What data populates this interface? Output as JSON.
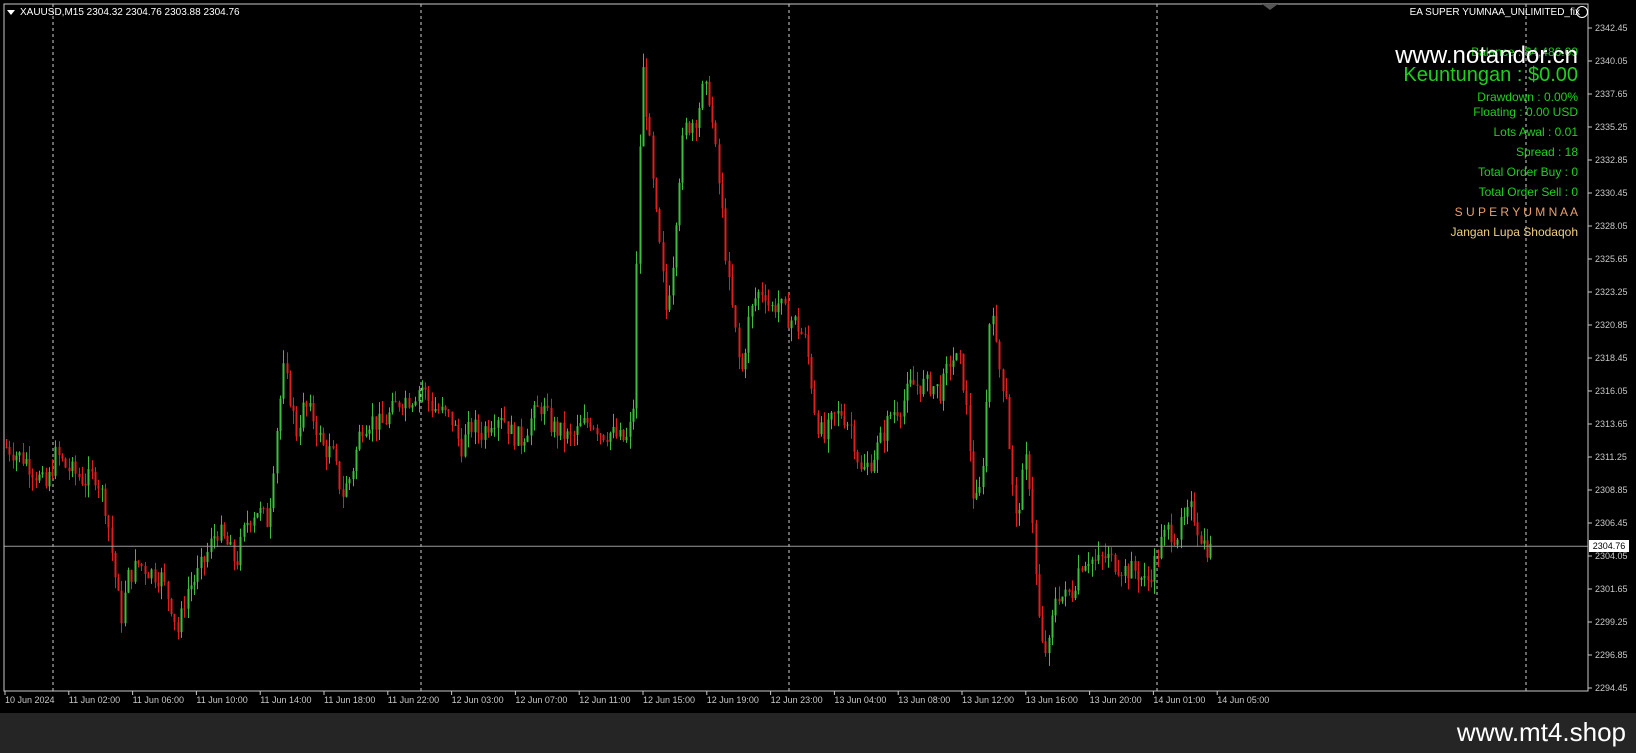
{
  "header": {
    "symbol_info": "XAUUSD,M15  2304.32 2304.76 2303.88 2304.76",
    "ea_name": "EA SUPER YUMNAA_UNLIMITED_fix"
  },
  "watermark": "www.notandor.cn",
  "panel": {
    "balance": "Balance : $4,486.09",
    "profit": "Keuntungan : $0.00",
    "drawdown": "Drawdown  : 0.00%",
    "floating": "Floating : 0.00 USD",
    "lots": "Lots Awal : 0.01",
    "spread": "Spread : 18",
    "total_buy": "Total Order Buy  :  0",
    "total_sell": "Total Order Sell  :  0",
    "brand": "S U P E R   Y U M N A A",
    "note": "Jangan Lupa Shodaqoh"
  },
  "footer": "www.mt4.shop",
  "colors": {
    "bull": "#3cbf3c",
    "bear": "#e01e1e",
    "panel_green": "#1fd01f",
    "brand_orange": "#e8a070",
    "note_yellow": "#f0d080"
  },
  "chart_data": {
    "type": "candlestick",
    "current_price": 2304.76,
    "current_price_label": "2304.76",
    "y_ticks": [
      "2342.45",
      "2340.05",
      "2337.65",
      "2335.25",
      "2332.85",
      "2330.45",
      "2328.05",
      "2325.65",
      "2323.25",
      "2320.85",
      "2318.45",
      "2316.05",
      "2313.65",
      "2311.25",
      "2308.85",
      "2306.45",
      "2304.05",
      "2301.65",
      "2299.25",
      "2296.85",
      "2294.45"
    ],
    "x_ticks": [
      "10 Jun 2024",
      "11 Jun 02:00",
      "11 Jun 06:00",
      "11 Jun 10:00",
      "11 Jun 14:00",
      "11 Jun 18:00",
      "11 Jun 22:00",
      "12 Jun 03:00",
      "12 Jun 07:00",
      "12 Jun 11:00",
      "12 Jun 15:00",
      "12 Jun 19:00",
      "12 Jun 23:00",
      "13 Jun 04:00",
      "13 Jun 08:00",
      "13 Jun 12:00",
      "13 Jun 16:00",
      "13 Jun 20:00",
      "14 Jun 01:00",
      "14 Jun 05:00"
    ],
    "close_path": [
      [
        0,
        2312.0
      ],
      [
        10,
        2311.5
      ],
      [
        20,
        2311.0
      ],
      [
        30,
        2310.0
      ],
      [
        40,
        2309.0
      ],
      [
        50,
        2311.5
      ],
      [
        60,
        2310.5
      ],
      [
        70,
        2310.0
      ],
      [
        80,
        2309.5
      ],
      [
        90,
        2310.0
      ],
      [
        100,
        2307.5
      ],
      [
        108,
        2303.0
      ],
      [
        115,
        2299.5
      ],
      [
        122,
        2302.5
      ],
      [
        132,
        2303.5
      ],
      [
        142,
        2303.0
      ],
      [
        155,
        2302.5
      ],
      [
        165,
        2300.5
      ],
      [
        172,
        2298.5
      ],
      [
        180,
        2301.5
      ],
      [
        190,
        2302.5
      ],
      [
        200,
        2304.0
      ],
      [
        210,
        2306.0
      ],
      [
        220,
        2305.0
      ],
      [
        230,
        2303.5
      ],
      [
        240,
        2306.5
      ],
      [
        250,
        2307.5
      ],
      [
        262,
        2306.5
      ],
      [
        270,
        2313.0
      ],
      [
        277,
        2317.5
      ],
      [
        283,
        2316.0
      ],
      [
        290,
        2313.0
      ],
      [
        298,
        2315.0
      ],
      [
        308,
        2314.0
      ],
      [
        316,
        2312.0
      ],
      [
        326,
        2311.5
      ],
      [
        336,
        2308.5
      ],
      [
        345,
        2310.0
      ],
      [
        355,
        2313.5
      ],
      [
        365,
        2314.0
      ],
      [
        375,
        2313.5
      ],
      [
        385,
        2314.5
      ],
      [
        395,
        2315.5
      ],
      [
        405,
        2315.5
      ],
      [
        415,
        2316.5
      ],
      [
        425,
        2315.0
      ],
      [
        435,
        2314.5
      ],
      [
        445,
        2314.0
      ],
      [
        455,
        2312.0
      ],
      [
        465,
        2313.5
      ],
      [
        475,
        2313.0
      ],
      [
        485,
        2314.0
      ],
      [
        495,
        2314.5
      ],
      [
        505,
        2313.0
      ],
      [
        515,
        2312.5
      ],
      [
        525,
        2314.0
      ],
      [
        535,
        2315.0
      ],
      [
        545,
        2313.5
      ],
      [
        555,
        2313.0
      ],
      [
        565,
        2312.5
      ],
      [
        575,
        2313.5
      ],
      [
        585,
        2314.0
      ],
      [
        595,
        2313.0
      ],
      [
        605,
        2313.0
      ],
      [
        615,
        2312.5
      ],
      [
        622,
        2312.5
      ],
      [
        627,
        2315.0
      ],
      [
        632,
        2330.0
      ],
      [
        636,
        2340.0
      ],
      [
        641,
        2336.0
      ],
      [
        648,
        2330.0
      ],
      [
        654,
        2326.0
      ],
      [
        660,
        2322.0
      ],
      [
        666,
        2325.0
      ],
      [
        672,
        2331.0
      ],
      [
        678,
        2335.0
      ],
      [
        684,
        2335.5
      ],
      [
        690,
        2336.0
      ],
      [
        697,
        2338.0
      ],
      [
        703,
        2337.5
      ],
      [
        710,
        2333.0
      ],
      [
        716,
        2329.0
      ],
      [
        722,
        2324.0
      ],
      [
        728,
        2321.0
      ],
      [
        735,
        2317.0
      ],
      [
        742,
        2321.0
      ],
      [
        750,
        2323.0
      ],
      [
        758,
        2323.5
      ],
      [
        764,
        2322.0
      ],
      [
        772,
        2322.5
      ],
      [
        780,
        2321.5
      ],
      [
        790,
        2321.0
      ],
      [
        800,
        2319.5
      ],
      [
        810,
        2314.0
      ],
      [
        818,
        2312.5
      ],
      [
        826,
        2314.0
      ],
      [
        835,
        2314.5
      ],
      [
        845,
        2313.5
      ],
      [
        855,
        2310.0
      ],
      [
        865,
        2311.0
      ],
      [
        875,
        2312.5
      ],
      [
        885,
        2314.5
      ],
      [
        895,
        2315.0
      ],
      [
        905,
        2316.5
      ],
      [
        915,
        2316.5
      ],
      [
        925,
        2316.5
      ],
      [
        935,
        2316.0
      ],
      [
        945,
        2318.5
      ],
      [
        955,
        2318.0
      ],
      [
        962,
        2313.5
      ],
      [
        968,
        2307.5
      ],
      [
        975,
        2309.0
      ],
      [
        980,
        2315.0
      ],
      [
        985,
        2324.0
      ],
      [
        990,
        2319.0
      ],
      [
        995,
        2317.0
      ],
      [
        1000,
        2316.0
      ],
      [
        1005,
        2310.0
      ],
      [
        1010,
        2306.5
      ],
      [
        1015,
        2309.0
      ],
      [
        1020,
        2311.0
      ],
      [
        1025,
        2308.5
      ],
      [
        1030,
        2302.0
      ],
      [
        1035,
        2297.5
      ],
      [
        1042,
        2297.0
      ],
      [
        1050,
        2301.5
      ],
      [
        1058,
        2301.0
      ],
      [
        1066,
        2301.5
      ],
      [
        1074,
        2303.5
      ],
      [
        1082,
        2304.0
      ],
      [
        1090,
        2303.5
      ],
      [
        1100,
        2304.0
      ],
      [
        1110,
        2303.5
      ],
      [
        1120,
        2303.0
      ],
      [
        1130,
        2303.0
      ],
      [
        1140,
        2302.0
      ],
      [
        1148,
        2303.5
      ],
      [
        1155,
        2305.0
      ],
      [
        1162,
        2306.0
      ],
      [
        1170,
        2305.5
      ],
      [
        1178,
        2306.5
      ],
      [
        1186,
        2307.5
      ],
      [
        1192,
        2306.0
      ],
      [
        1198,
        2305.0
      ],
      [
        1203,
        2304.5
      ],
      [
        1208,
        2304.5
      ],
      [
        1212,
        2304.76
      ]
    ]
  }
}
